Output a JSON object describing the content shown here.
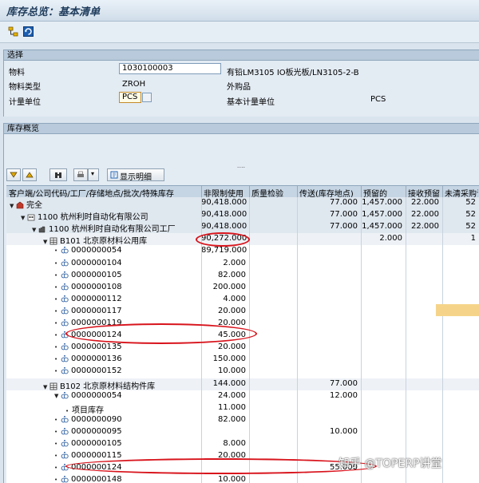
{
  "window": {
    "title": "库存总览：基本清单"
  },
  "selection": {
    "header": "选择",
    "material_label": "物料",
    "material_value": "1030100003",
    "material_desc": "有铅LM3105 IO板光板/LN3105-2-B",
    "mtype_label": "物料类型",
    "mtype_value": "ZROH",
    "mtype_desc": "外购品",
    "uom_label": "计量单位",
    "uom_value": "PCS",
    "base_uom_label": "基本计量单位",
    "base_uom_value": "PCS"
  },
  "overview": {
    "header": "库存概览",
    "splitter": "....",
    "toolbar": {
      "detail_label": "显示明细"
    }
  },
  "grid": {
    "columns": [
      "客户端/公司代码/工厂/存储地点/批次/特殊库存",
      "非限制使用",
      "质量检验",
      "传送(库存地点)",
      "预留的",
      "接收预留",
      "未清采购订"
    ],
    "rows": [
      {
        "label": "完全",
        "level": 0,
        "type": "agg",
        "icon": "client-icon",
        "exp": "▼",
        "c1": "90,418.000",
        "c2": "",
        "c3": "77.000",
        "c4": "1,457.000",
        "c5": "22.000",
        "c6": "52"
      },
      {
        "label": "1100 杭州利时自动化有限公司",
        "level": 1,
        "type": "agg",
        "icon": "company-icon",
        "exp": "▼",
        "c1": "90,418.000",
        "c2": "",
        "c3": "77.000",
        "c4": "1,457.000",
        "c5": "22.000",
        "c6": "52"
      },
      {
        "label": "1100 杭州利时自动化有限公司工厂",
        "level": 2,
        "type": "agg",
        "icon": "plant-icon",
        "exp": "▼",
        "c1": "90,418.000",
        "c2": "",
        "c3": "77.000",
        "c4": "1,457.000",
        "c5": "22.000",
        "c6": "52"
      },
      {
        "label": "B101 北京原材料公用库",
        "level": 3,
        "type": "lvl3",
        "icon": "storage-icon",
        "exp": "▼",
        "c1": "90,272.000",
        "c2": "",
        "c3": "",
        "c4": "2.000",
        "c5": "",
        "c6": "1"
      },
      {
        "label": "0000000054",
        "level": 4,
        "type": "batch",
        "icon": "batch-icon",
        "exp": "•",
        "c1": "89,719.000",
        "c2": "",
        "c3": "",
        "c4": "",
        "c5": "",
        "c6": ""
      },
      {
        "label": "0000000104",
        "level": 4,
        "type": "batch",
        "icon": "batch-icon",
        "exp": "•",
        "c1": "2.000",
        "c2": "",
        "c3": "",
        "c4": "",
        "c5": "",
        "c6": ""
      },
      {
        "label": "0000000105",
        "level": 4,
        "type": "batch",
        "icon": "batch-icon",
        "exp": "•",
        "c1": "82.000",
        "c2": "",
        "c3": "",
        "c4": "",
        "c5": "",
        "c6": ""
      },
      {
        "label": "0000000108",
        "level": 4,
        "type": "batch",
        "icon": "batch-icon",
        "exp": "•",
        "c1": "200.000",
        "c2": "",
        "c3": "",
        "c4": "",
        "c5": "",
        "c6": ""
      },
      {
        "label": "0000000112",
        "level": 4,
        "type": "batch",
        "icon": "batch-icon",
        "exp": "•",
        "c1": "4.000",
        "c2": "",
        "c3": "",
        "c4": "",
        "c5": "",
        "c6": ""
      },
      {
        "label": "0000000117",
        "level": 4,
        "type": "batch",
        "icon": "batch-icon",
        "exp": "•",
        "c1": "20.000",
        "c2": "",
        "c3": "",
        "c4": "",
        "c5": "",
        "c6": ""
      },
      {
        "label": "0000000119",
        "level": 4,
        "type": "batch",
        "icon": "batch-icon",
        "exp": "•",
        "c1": "20.000",
        "c2": "",
        "c3": "",
        "c4": "",
        "c5": "",
        "c6": ""
      },
      {
        "label": "0000000124",
        "level": 4,
        "type": "batch",
        "icon": "batch-icon",
        "exp": "•",
        "c1": "45.000",
        "c2": "",
        "c3": "",
        "c4": "",
        "c5": "",
        "c6": ""
      },
      {
        "label": "0000000135",
        "level": 4,
        "type": "batch",
        "icon": "batch-icon",
        "exp": "•",
        "c1": "20.000",
        "c2": "",
        "c3": "",
        "c4": "",
        "c5": "",
        "c6": ""
      },
      {
        "label": "0000000136",
        "level": 4,
        "type": "batch",
        "icon": "batch-icon",
        "exp": "•",
        "c1": "150.000",
        "c2": "",
        "c3": "",
        "c4": "",
        "c5": "",
        "c6": ""
      },
      {
        "label": "0000000152",
        "level": 4,
        "type": "batch",
        "icon": "batch-icon",
        "exp": "•",
        "c1": "10.000",
        "c2": "",
        "c3": "",
        "c4": "",
        "c5": "",
        "c6": ""
      },
      {
        "label": "B102 北京原材料结构件库",
        "level": 3,
        "type": "lvl3",
        "icon": "storage-icon",
        "exp": "▼",
        "c1": "144.000",
        "c2": "",
        "c3": "77.000",
        "c4": "",
        "c5": "",
        "c6": ""
      },
      {
        "label": "0000000054",
        "level": 4,
        "type": "batch",
        "icon": "batch-icon",
        "exp": "▼",
        "c1": "24.000",
        "c2": "",
        "c3": "12.000",
        "c4": "",
        "c5": "",
        "c6": ""
      },
      {
        "label": "项目库存",
        "level": 5,
        "type": "batch",
        "icon": "",
        "exp": "•",
        "c1": "11.000",
        "c2": "",
        "c3": "",
        "c4": "",
        "c5": "",
        "c6": ""
      },
      {
        "label": "0000000090",
        "level": 4,
        "type": "batch",
        "icon": "batch-icon",
        "exp": "•",
        "c1": "82.000",
        "c2": "",
        "c3": "",
        "c4": "",
        "c5": "",
        "c6": ""
      },
      {
        "label": "0000000095",
        "level": 4,
        "type": "batch",
        "icon": "batch-icon",
        "exp": "•",
        "c1": "",
        "c2": "",
        "c3": "10.000",
        "c4": "",
        "c5": "",
        "c6": ""
      },
      {
        "label": "0000000105",
        "level": 4,
        "type": "batch",
        "icon": "batch-icon",
        "exp": "•",
        "c1": "8.000",
        "c2": "",
        "c3": "",
        "c4": "",
        "c5": "",
        "c6": ""
      },
      {
        "label": "0000000115",
        "level": 4,
        "type": "batch",
        "icon": "batch-icon",
        "exp": "•",
        "c1": "20.000",
        "c2": "",
        "c3": "",
        "c4": "",
        "c5": "",
        "c6": ""
      },
      {
        "label": "0000000124",
        "level": 4,
        "type": "batch",
        "icon": "batch-icon",
        "exp": "•",
        "c1": "",
        "c2": "",
        "c3": "55.000",
        "c4": "",
        "c5": "",
        "c6": ""
      },
      {
        "label": "0000000148",
        "level": 4,
        "type": "batch",
        "icon": "batch-icon",
        "exp": "•",
        "c1": "10.000",
        "c2": "",
        "c3": "",
        "c4": "",
        "c5": "",
        "c6": ""
      }
    ]
  },
  "watermark": "知乎 @TOPERP讲堂",
  "colors": {
    "annotation": "#d8141c",
    "highlight": "#f5d48a"
  }
}
